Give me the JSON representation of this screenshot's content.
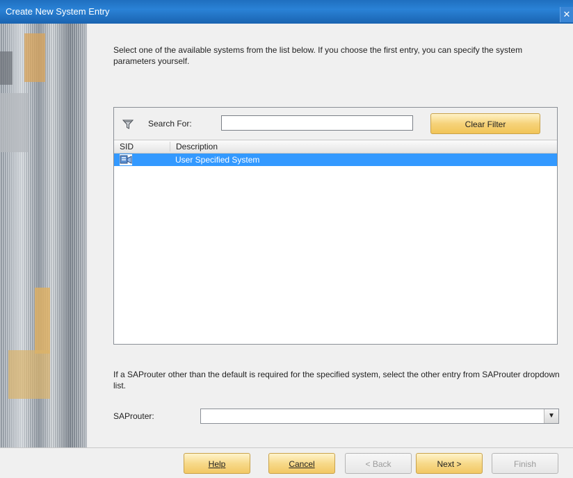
{
  "window": {
    "title": "Create New System Entry",
    "close_label": "✕"
  },
  "intro": "Select one of the available systems from the list below. If you choose the first entry, you can specify the system parameters yourself.",
  "search": {
    "label": "Search For:",
    "value": "",
    "placeholder": "",
    "clear_button": "Clear Filter"
  },
  "table": {
    "headers": [
      "SID",
      "Description"
    ],
    "rows": [
      {
        "sid": "",
        "description": "User Specified System",
        "selected": true
      }
    ]
  },
  "saprouter": {
    "info": "If a SAProuter other than the default is required for the specified system, select the other entry from SAProuter dropdown list.",
    "label": "SAProuter:",
    "value": ""
  },
  "buttons": {
    "help": "Help",
    "cancel": "Cancel",
    "back": "< Back",
    "next": "Next >",
    "finish": "Finish"
  },
  "colors": {
    "title_bar": "#2a82d6",
    "selection": "#3399ff",
    "button_gold": "#f6d37a"
  }
}
